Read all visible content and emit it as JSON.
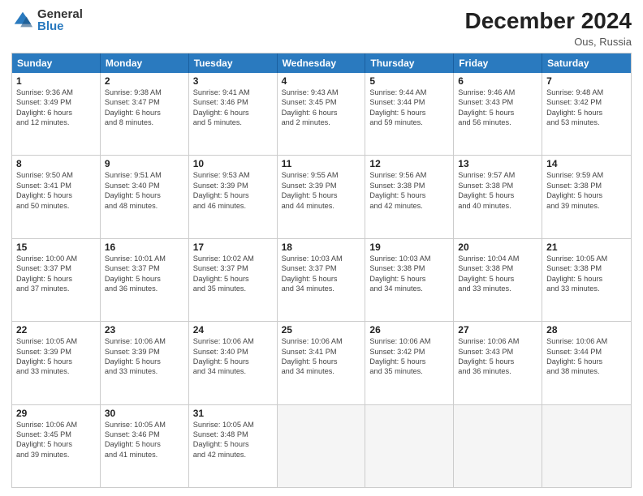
{
  "logo": {
    "general": "General",
    "blue": "Blue"
  },
  "title": "December 2024",
  "subtitle": "Ous, Russia",
  "days_of_week": [
    "Sunday",
    "Monday",
    "Tuesday",
    "Wednesday",
    "Thursday",
    "Friday",
    "Saturday"
  ],
  "weeks": [
    [
      {
        "day": "1",
        "info": "Sunrise: 9:36 AM\nSunset: 3:49 PM\nDaylight: 6 hours\nand 12 minutes."
      },
      {
        "day": "2",
        "info": "Sunrise: 9:38 AM\nSunset: 3:47 PM\nDaylight: 6 hours\nand 8 minutes."
      },
      {
        "day": "3",
        "info": "Sunrise: 9:41 AM\nSunset: 3:46 PM\nDaylight: 6 hours\nand 5 minutes."
      },
      {
        "day": "4",
        "info": "Sunrise: 9:43 AM\nSunset: 3:45 PM\nDaylight: 6 hours\nand 2 minutes."
      },
      {
        "day": "5",
        "info": "Sunrise: 9:44 AM\nSunset: 3:44 PM\nDaylight: 5 hours\nand 59 minutes."
      },
      {
        "day": "6",
        "info": "Sunrise: 9:46 AM\nSunset: 3:43 PM\nDaylight: 5 hours\nand 56 minutes."
      },
      {
        "day": "7",
        "info": "Sunrise: 9:48 AM\nSunset: 3:42 PM\nDaylight: 5 hours\nand 53 minutes."
      }
    ],
    [
      {
        "day": "8",
        "info": "Sunrise: 9:50 AM\nSunset: 3:41 PM\nDaylight: 5 hours\nand 50 minutes."
      },
      {
        "day": "9",
        "info": "Sunrise: 9:51 AM\nSunset: 3:40 PM\nDaylight: 5 hours\nand 48 minutes."
      },
      {
        "day": "10",
        "info": "Sunrise: 9:53 AM\nSunset: 3:39 PM\nDaylight: 5 hours\nand 46 minutes."
      },
      {
        "day": "11",
        "info": "Sunrise: 9:55 AM\nSunset: 3:39 PM\nDaylight: 5 hours\nand 44 minutes."
      },
      {
        "day": "12",
        "info": "Sunrise: 9:56 AM\nSunset: 3:38 PM\nDaylight: 5 hours\nand 42 minutes."
      },
      {
        "day": "13",
        "info": "Sunrise: 9:57 AM\nSunset: 3:38 PM\nDaylight: 5 hours\nand 40 minutes."
      },
      {
        "day": "14",
        "info": "Sunrise: 9:59 AM\nSunset: 3:38 PM\nDaylight: 5 hours\nand 39 minutes."
      }
    ],
    [
      {
        "day": "15",
        "info": "Sunrise: 10:00 AM\nSunset: 3:37 PM\nDaylight: 5 hours\nand 37 minutes."
      },
      {
        "day": "16",
        "info": "Sunrise: 10:01 AM\nSunset: 3:37 PM\nDaylight: 5 hours\nand 36 minutes."
      },
      {
        "day": "17",
        "info": "Sunrise: 10:02 AM\nSunset: 3:37 PM\nDaylight: 5 hours\nand 35 minutes."
      },
      {
        "day": "18",
        "info": "Sunrise: 10:03 AM\nSunset: 3:37 PM\nDaylight: 5 hours\nand 34 minutes."
      },
      {
        "day": "19",
        "info": "Sunrise: 10:03 AM\nSunset: 3:38 PM\nDaylight: 5 hours\nand 34 minutes."
      },
      {
        "day": "20",
        "info": "Sunrise: 10:04 AM\nSunset: 3:38 PM\nDaylight: 5 hours\nand 33 minutes."
      },
      {
        "day": "21",
        "info": "Sunrise: 10:05 AM\nSunset: 3:38 PM\nDaylight: 5 hours\nand 33 minutes."
      }
    ],
    [
      {
        "day": "22",
        "info": "Sunrise: 10:05 AM\nSunset: 3:39 PM\nDaylight: 5 hours\nand 33 minutes."
      },
      {
        "day": "23",
        "info": "Sunrise: 10:06 AM\nSunset: 3:39 PM\nDaylight: 5 hours\nand 33 minutes."
      },
      {
        "day": "24",
        "info": "Sunrise: 10:06 AM\nSunset: 3:40 PM\nDaylight: 5 hours\nand 34 minutes."
      },
      {
        "day": "25",
        "info": "Sunrise: 10:06 AM\nSunset: 3:41 PM\nDaylight: 5 hours\nand 34 minutes."
      },
      {
        "day": "26",
        "info": "Sunrise: 10:06 AM\nSunset: 3:42 PM\nDaylight: 5 hours\nand 35 minutes."
      },
      {
        "day": "27",
        "info": "Sunrise: 10:06 AM\nSunset: 3:43 PM\nDaylight: 5 hours\nand 36 minutes."
      },
      {
        "day": "28",
        "info": "Sunrise: 10:06 AM\nSunset: 3:44 PM\nDaylight: 5 hours\nand 38 minutes."
      }
    ],
    [
      {
        "day": "29",
        "info": "Sunrise: 10:06 AM\nSunset: 3:45 PM\nDaylight: 5 hours\nand 39 minutes."
      },
      {
        "day": "30",
        "info": "Sunrise: 10:05 AM\nSunset: 3:46 PM\nDaylight: 5 hours\nand 41 minutes."
      },
      {
        "day": "31",
        "info": "Sunrise: 10:05 AM\nSunset: 3:48 PM\nDaylight: 5 hours\nand 42 minutes."
      },
      {
        "day": "",
        "info": ""
      },
      {
        "day": "",
        "info": ""
      },
      {
        "day": "",
        "info": ""
      },
      {
        "day": "",
        "info": ""
      }
    ]
  ]
}
